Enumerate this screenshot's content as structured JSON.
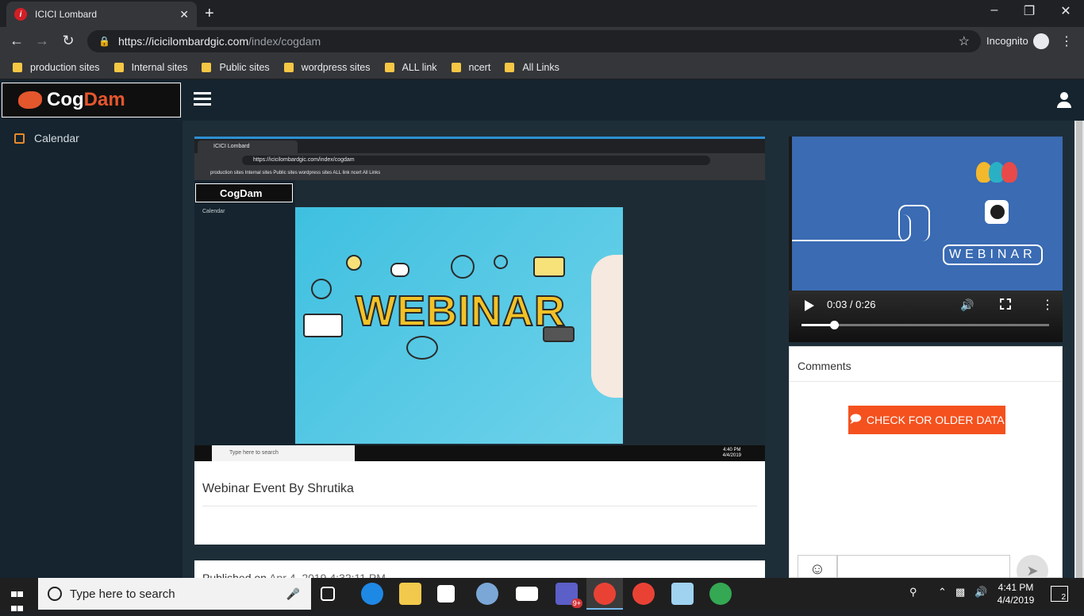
{
  "browser": {
    "tab_title": "ICICI Lombard",
    "tab_close": "✕",
    "new_tab": "+",
    "url_host": "https://icicilombardgic.com",
    "url_path": "/index/cogdam",
    "incognito_label": "Incognito",
    "bookmarks": [
      "production sites",
      "Internal sites",
      "Public sites",
      "wordpress sites",
      "ALL link",
      "ncert",
      "All Links"
    ]
  },
  "app": {
    "logo_text_a": "Cog",
    "logo_text_b": "Dam",
    "sidebar_item": "Calendar"
  },
  "main": {
    "video_title": "Webinar Event By Shrutika",
    "published_label": "Published on",
    "published_date": "Apr 4, 2019 4:32:11 PM",
    "embedded_shot": {
      "tab_title": "ICICI Lombard",
      "url": "https://icicilombardgic.com/index/cogdam",
      "bookmarks": "production sites   Internal sites   Public sites   wordpress sites   ALL link   ncert   All Links",
      "logo": "CogDam",
      "sidebar_item": "Calendar",
      "headline": "WEBINAR",
      "search_placeholder": "Type here to search",
      "time": "4:40 PM",
      "date": "4/4/2019"
    }
  },
  "player": {
    "brand_word": "WEBINAR",
    "time_display": "0:03 / 0:26",
    "progress_fraction": 0.13
  },
  "comments": {
    "heading": "Comments",
    "older_button": "CHECK FOR OLDER DATA"
  },
  "taskbar": {
    "search_placeholder": "Type here to search",
    "time": "4:41 PM",
    "date": "4/4/2019",
    "notification_count": "2",
    "teams_badge": "9+"
  },
  "colors": {
    "accent_orange": "#f4511e",
    "card_top_border": "#2e8fd3",
    "sidebar_bg": "#15242e"
  }
}
